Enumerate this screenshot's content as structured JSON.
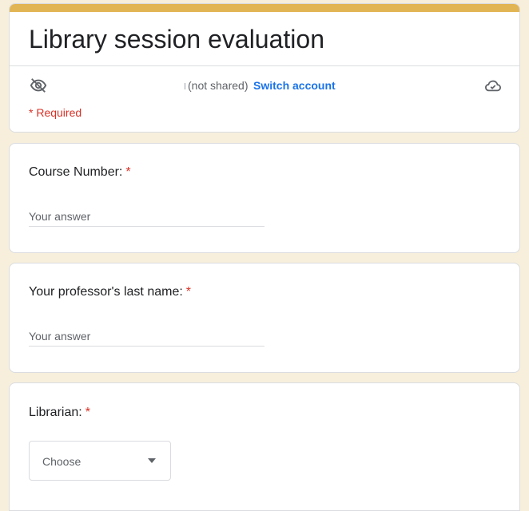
{
  "form": {
    "title": "Library session evaluation",
    "account_status": "(not shared)",
    "switch_account": "Switch account",
    "required_note": "* Required"
  },
  "questions": [
    {
      "label": "Course Number:",
      "required_mark": "*",
      "placeholder": "Your answer"
    },
    {
      "label": "Your professor's last name:",
      "required_mark": "*",
      "placeholder": "Your answer"
    },
    {
      "label": "Librarian:",
      "required_mark": "*",
      "dropdown_value": "Choose"
    }
  ],
  "icons": {
    "visibility": "eye-off-icon",
    "cloud": "cloud-done-icon",
    "dropdown": "caret-down-icon"
  },
  "colors": {
    "accent": "#e2b554",
    "background": "#f7efdc",
    "required": "#d93025",
    "link": "#1a73e8"
  }
}
